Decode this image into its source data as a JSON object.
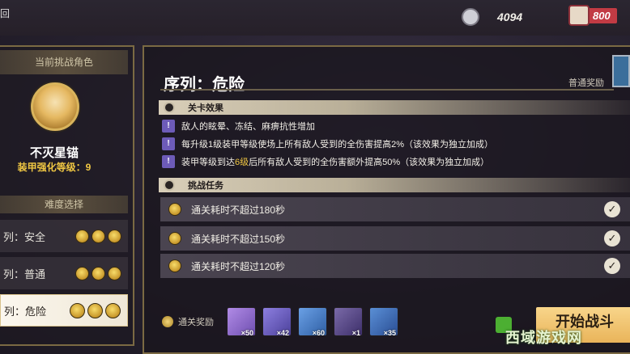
{
  "topbar": {
    "back_label": "回",
    "resource1": {
      "icon": "crystal-icon",
      "value": "4094"
    },
    "resource2": {
      "icon": "stamina-icon",
      "value": "800"
    }
  },
  "left_panel": {
    "header": "当前挑战角色",
    "character": {
      "name": "不灭星锚",
      "level_text": "装甲强化等级：9"
    },
    "difficulty_header": "难度选择",
    "difficulties": [
      {
        "label": "列：安全",
        "medals": 3,
        "selected": false
      },
      {
        "label": "列：普通",
        "medals": 3,
        "selected": false
      },
      {
        "label": "列：危险",
        "medals": 3,
        "selected": true
      }
    ]
  },
  "main": {
    "title": "序列：危险",
    "normal_reward_label": "普通奖励",
    "effects_header": "关卡效果",
    "effects": [
      {
        "parts": [
          "敌人的眩晕、冻结、麻痹抗性增加"
        ]
      },
      {
        "parts": [
          "每升级1级装甲等级使场上所有敌人受到的全伤害提高2%（该效果为独立加成）"
        ]
      },
      {
        "parts": [
          "装甲等级到达",
          "6级",
          "后所有敌人受到的全伤害额外提高50%（该效果为独立加成）"
        ]
      }
    ],
    "missions_header": "挑战任务",
    "missions": [
      {
        "label": "通关耗时不超过180秒",
        "done": true
      },
      {
        "label": "通关耗时不超过150秒",
        "done": true
      },
      {
        "label": "通关耗时不超过120秒",
        "done": true
      }
    ],
    "clear_reward_label": "通关奖励",
    "rewards": [
      {
        "qty": "×50",
        "color": "#9b77d1"
      },
      {
        "qty": "×42",
        "color": "#6f63c7"
      },
      {
        "qty": "×60",
        "color": "#4a7fc4"
      },
      {
        "qty": "×1",
        "color": "#5b4a8e"
      },
      {
        "qty": "×35",
        "color": "#3e6fb8"
      }
    ],
    "start_button": "开始战斗"
  },
  "watermark": "西域游戏网"
}
